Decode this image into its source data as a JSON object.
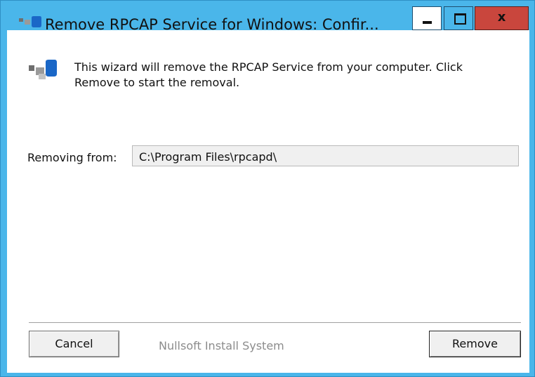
{
  "window": {
    "title": "Remove RPCAP Service for Windows: Confir...",
    "controls": {
      "minimize_icon": "minimize-icon",
      "maximize_icon": "maximize-icon",
      "close_label": "x"
    }
  },
  "header": {
    "icon": "rpcap-installer-icon",
    "intro": "This wizard will remove the RPCAP Service from your computer. Click Remove to start the removal."
  },
  "main": {
    "removing_label": "Removing from:",
    "removing_path": "C:\\Program Files\\rpcapd\\"
  },
  "footer": {
    "cancel_label": "Cancel",
    "branding": "Nullsoft Install System",
    "remove_label": "Remove"
  },
  "colors": {
    "title_bar": "#4ab6ea",
    "close_button": "#c9463d",
    "branding_text": "#8c8c8c"
  }
}
